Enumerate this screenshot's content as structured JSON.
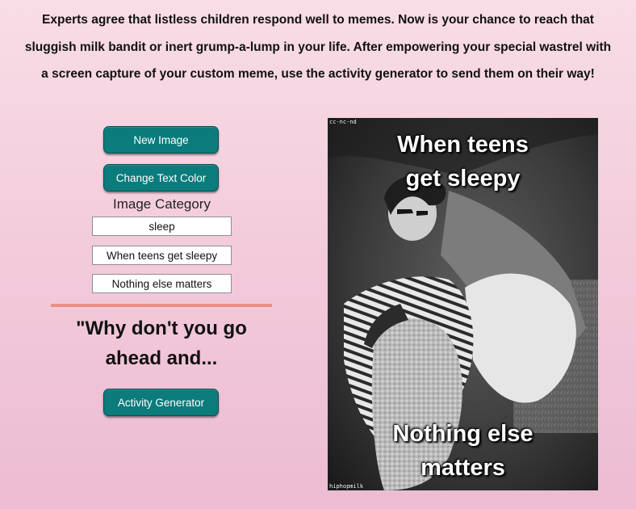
{
  "intro": {
    "line1": "Experts agree that listless children respond well to memes. Now is your chance to reach that",
    "line2": "sluggish milk bandit or inert grump-a-lump in your life. After empowering your special wastrel with",
    "line3": "a screen capture of your custom meme, use the activity generator to send them on their way!"
  },
  "controls": {
    "new_image_label": "New Image",
    "change_color_label": "Change Text Color",
    "category_label": "Image Category",
    "category_value": "sleep",
    "top_text_value": "When teens get sleepy",
    "bottom_text_value": "Nothing else matters"
  },
  "quote": {
    "line1": "\"Why don't you go",
    "line2": "ahead and..."
  },
  "activity": {
    "button_label": "Activity Generator"
  },
  "meme": {
    "top_line1": "When teens",
    "top_line2": "get sleepy",
    "bottom_line1": "Nothing else",
    "bottom_line2": "matters",
    "license_text": "cc-nc-nd",
    "credit_text": "hiphopmilk",
    "text_color": "#ffffff"
  },
  "colors": {
    "button": "#0b7b7b",
    "divider": "#ea8d83",
    "background_top": "#f8dde6",
    "background_bottom": "#ecbcd2"
  }
}
